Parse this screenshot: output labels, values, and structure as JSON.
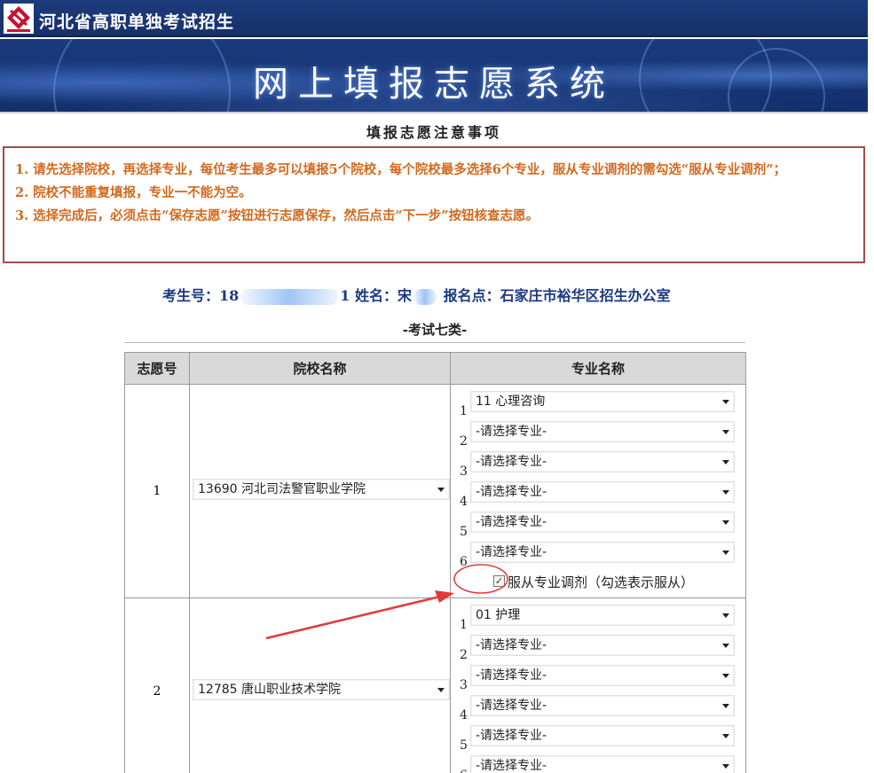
{
  "header": {
    "site_title": "河北省高职单独考试招生",
    "banner_title": "网上填报志愿系统"
  },
  "notes": {
    "title": "填报志愿注意事项",
    "items": [
      "1. 请先选择院校，再选择专业，每位考生最多可以填报5个院校，每个院校最多选择6个专业，服从专业调剂的需勾选“服从专业调剂”；",
      "2. 院校不能重复填报，专业一不能为空。",
      "3. 选择完成后，必须点击“保存志愿”按钮进行志愿保存，然后点击“下一步”按钮核查志愿。"
    ]
  },
  "student": {
    "id_label": "考生号：",
    "id_prefix": "18",
    "id_suffix": "1",
    "name_label": "姓名：",
    "name_visible": "宋",
    "office_label": "报名点：",
    "office": "石家庄市裕华区招生办公室"
  },
  "exam_type": "-考试七类-",
  "table": {
    "headers": [
      "志愿号",
      "院校名称",
      "专业名称"
    ],
    "rows": [
      {
        "no": "1",
        "school": "13690 河北司法警官职业学院",
        "majors": [
          "11 心理咨询",
          "-请选择专业-",
          "-请选择专业-",
          "-请选择专业-",
          "-请选择专业-",
          "-请选择专业-"
        ],
        "adjust_checked": true,
        "adjust_label": "服从专业调剂（勾选表示服从）"
      },
      {
        "no": "2",
        "school": "12785 唐山职业技术学院",
        "majors": [
          "01 护理",
          "-请选择专业-",
          "-请选择专业-",
          "-请选择专业-",
          "-请选择专业-",
          "-请选择专业-"
        ]
      }
    ],
    "major_numbers": [
      "1",
      "2",
      "3",
      "4",
      "5",
      "6"
    ],
    "check_mark": "✓"
  },
  "colors": {
    "header_blue": "#16306a",
    "notes_text": "#d2691e",
    "notes_border": "#a44a4a",
    "info_text": "#1b3a82",
    "annotation_red": "#e23a3a"
  }
}
